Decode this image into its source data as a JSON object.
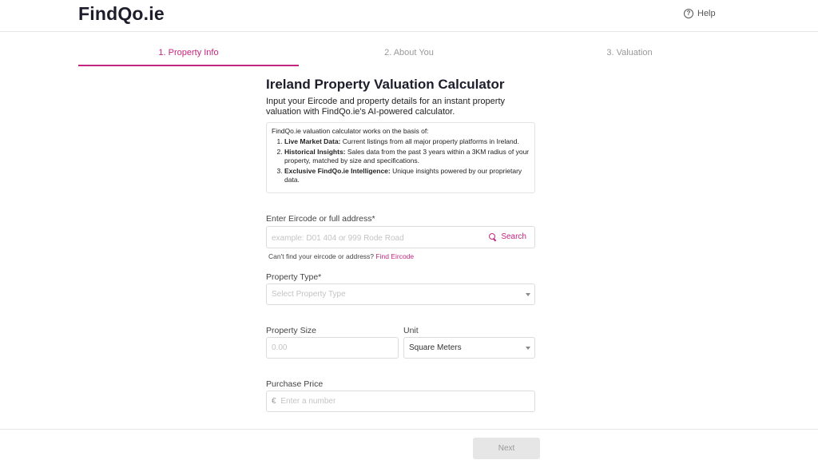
{
  "header": {
    "logo": "FindQo.ie",
    "help_label": "Help",
    "help_icon": "?"
  },
  "steps": [
    {
      "label": "1. Property Info",
      "active": true
    },
    {
      "label": "2. About You",
      "active": false
    },
    {
      "label": "3. Valuation",
      "active": false
    }
  ],
  "main": {
    "title": "Ireland Property Valuation Calculator",
    "subtitle": "Input your Eircode and property details for an instant property valuation with FindQo.ie's AI-powered calculator.",
    "info": {
      "intro": "FindQo.ie valuation calculator works on the basis of:",
      "items": [
        {
          "heading": "Live Market Data:",
          "text": " Current listings from all major property platforms in Ireland."
        },
        {
          "heading": "Historical Insights:",
          "text": " Sales data from the past 3 years within a 3KM radius of your property, matched by size and specifications."
        },
        {
          "heading": "Exclusive FindQo.ie Intelligence:",
          "text": " Unique insights powered by our proprietary data."
        }
      ]
    }
  },
  "form": {
    "eircode": {
      "label": "Enter Eircode or full address*",
      "placeholder": "example: D01 404 or 999 Rode Road",
      "search_label": "Search",
      "hint_text": "Can't find your eircode or address?",
      "hint_link": "Find Eircode"
    },
    "property_type": {
      "label": "Property Type*",
      "placeholder": "Select Property Type"
    },
    "property_size": {
      "label": "Property Size",
      "placeholder": "0.00"
    },
    "unit": {
      "label": "Unit",
      "value": "Square Meters"
    },
    "purchase_price": {
      "label": "Purchase Price",
      "currency": "€",
      "placeholder": "Enter a number"
    }
  },
  "footer": {
    "next_label": "Next"
  },
  "colors": {
    "accent": "#c2267e",
    "text": "#1d1d2b",
    "border": "#dcdcdc",
    "disabled_bg": "#e6e6e6"
  }
}
